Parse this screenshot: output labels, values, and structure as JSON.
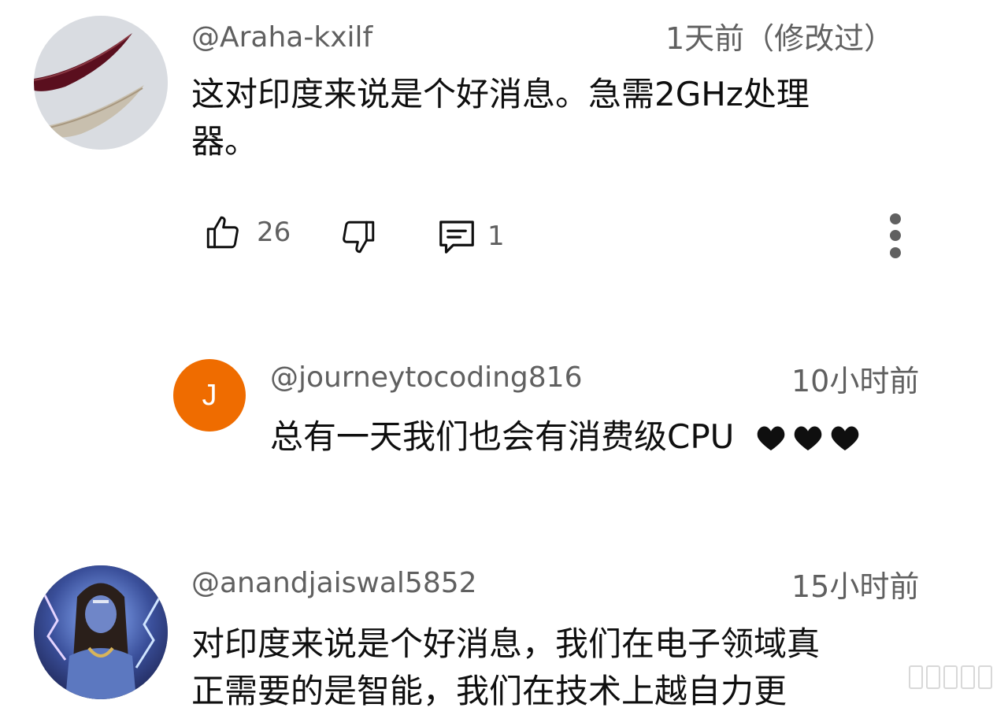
{
  "comments": [
    {
      "handle": "@Araha-kxilf",
      "time": "1天前（修改过）",
      "text_line1": "这对印度来说是个好消息。急需2GHz处理",
      "text_line2": "器。",
      "likes": "26",
      "replies": "1"
    },
    {
      "avatar_letter": "J",
      "avatar_color": "#ef6c00",
      "handle": "@journeytocoding816",
      "time": "10小时前",
      "text": "总有一天我们也会有消费级CPU"
    },
    {
      "handle": "@anandjaiswal5852",
      "time": "15小时前",
      "text_line1": "对印度来说是个好消息，我们在电子领域真",
      "text_line2": "正需要的是智能，我们在技术上越自力更"
    }
  ]
}
